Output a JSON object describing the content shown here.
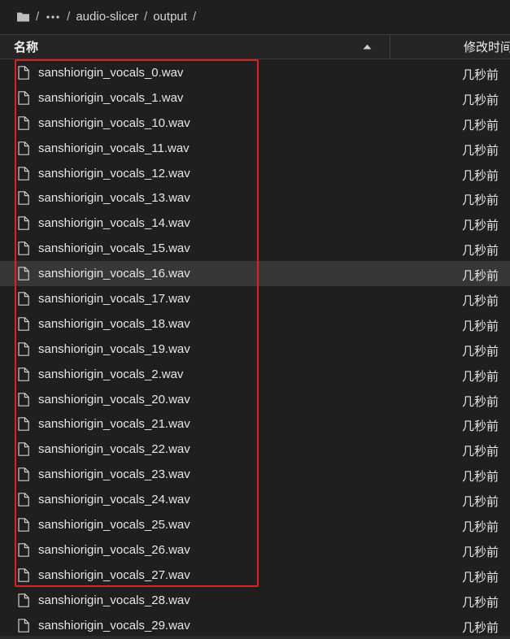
{
  "breadcrumb": {
    "folder_icon": "folder-icon",
    "root_sep": "/",
    "more_icon": "more-horizontal-icon",
    "parts": [
      "audio-slicer",
      "output"
    ],
    "sep": "/"
  },
  "table": {
    "col_name": "名称",
    "sort_icon": "sort-ascending-icon",
    "col_modified": "修改时间"
  },
  "files": [
    {
      "name": "sanshiorigin_vocals_0.wav",
      "modified": "几秒前"
    },
    {
      "name": "sanshiorigin_vocals_1.wav",
      "modified": "几秒前"
    },
    {
      "name": "sanshiorigin_vocals_10.wav",
      "modified": "几秒前"
    },
    {
      "name": "sanshiorigin_vocals_11.wav",
      "modified": "几秒前"
    },
    {
      "name": "sanshiorigin_vocals_12.wav",
      "modified": "几秒前"
    },
    {
      "name": "sanshiorigin_vocals_13.wav",
      "modified": "几秒前"
    },
    {
      "name": "sanshiorigin_vocals_14.wav",
      "modified": "几秒前"
    },
    {
      "name": "sanshiorigin_vocals_15.wav",
      "modified": "几秒前"
    },
    {
      "name": "sanshiorigin_vocals_16.wav",
      "modified": "几秒前"
    },
    {
      "name": "sanshiorigin_vocals_17.wav",
      "modified": "几秒前"
    },
    {
      "name": "sanshiorigin_vocals_18.wav",
      "modified": "几秒前"
    },
    {
      "name": "sanshiorigin_vocals_19.wav",
      "modified": "几秒前"
    },
    {
      "name": "sanshiorigin_vocals_2.wav",
      "modified": "几秒前"
    },
    {
      "name": "sanshiorigin_vocals_20.wav",
      "modified": "几秒前"
    },
    {
      "name": "sanshiorigin_vocals_21.wav",
      "modified": "几秒前"
    },
    {
      "name": "sanshiorigin_vocals_22.wav",
      "modified": "几秒前"
    },
    {
      "name": "sanshiorigin_vocals_23.wav",
      "modified": "几秒前"
    },
    {
      "name": "sanshiorigin_vocals_24.wav",
      "modified": "几秒前"
    },
    {
      "name": "sanshiorigin_vocals_25.wav",
      "modified": "几秒前"
    },
    {
      "name": "sanshiorigin_vocals_26.wav",
      "modified": "几秒前"
    },
    {
      "name": "sanshiorigin_vocals_27.wav",
      "modified": "几秒前"
    },
    {
      "name": "sanshiorigin_vocals_28.wav",
      "modified": "几秒前"
    },
    {
      "name": "sanshiorigin_vocals_29.wav",
      "modified": "几秒前"
    }
  ],
  "hovered_index": 8,
  "file_icon": "file-icon",
  "colors": {
    "background": "#1f1f1f",
    "header_bg": "#252525",
    "hover_row": "#373737",
    "annotation_box": "#e02020",
    "text": "#e6e6e6"
  }
}
